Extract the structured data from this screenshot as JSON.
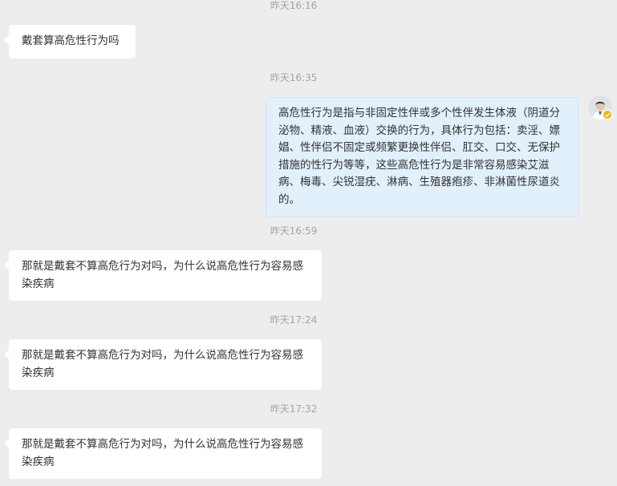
{
  "colors": {
    "background": "#ededed",
    "incoming_bubble": "#ffffff",
    "outgoing_bubble": "#e2f0fb",
    "timestamp": "#a4a4a4",
    "text": "#333333",
    "badge": "#f5b400"
  },
  "messages": [
    {
      "time": "昨天16:16"
    },
    {
      "text": "戴套算高危性行为吗"
    },
    {
      "time": "昨天16:35"
    },
    {
      "text": "高危性行为是指与非固定性伴或多个性伴发生体液（阴道分泌物、精液、血液）交换的行为，具体行为包括：卖淫、嫖娼、性伴侣不固定或频繁更换性伴侣、肛交、口交、无保护措施的性行为等等，这些高危性行为是非常容易感染艾滋病、梅毒、尖锐湿疣、淋病、生殖器疱疹、非淋菌性尿道炎的。",
      "avatar_icon": "doctor-avatar-icon",
      "badge_icon": "verified-badge-icon"
    },
    {
      "time": "昨天16:59"
    },
    {
      "text": "那就是戴套不算高危行为对吗，为什么说高危性行为容易感染疾病"
    },
    {
      "time": "昨天17:24"
    },
    {
      "text": "那就是戴套不算高危行为对吗，为什么说高危性行为容易感染疾病"
    },
    {
      "time": "昨天17:32"
    },
    {
      "text": "那就是戴套不算高危行为对吗，为什么说高危性行为容易感染疾病"
    }
  ]
}
